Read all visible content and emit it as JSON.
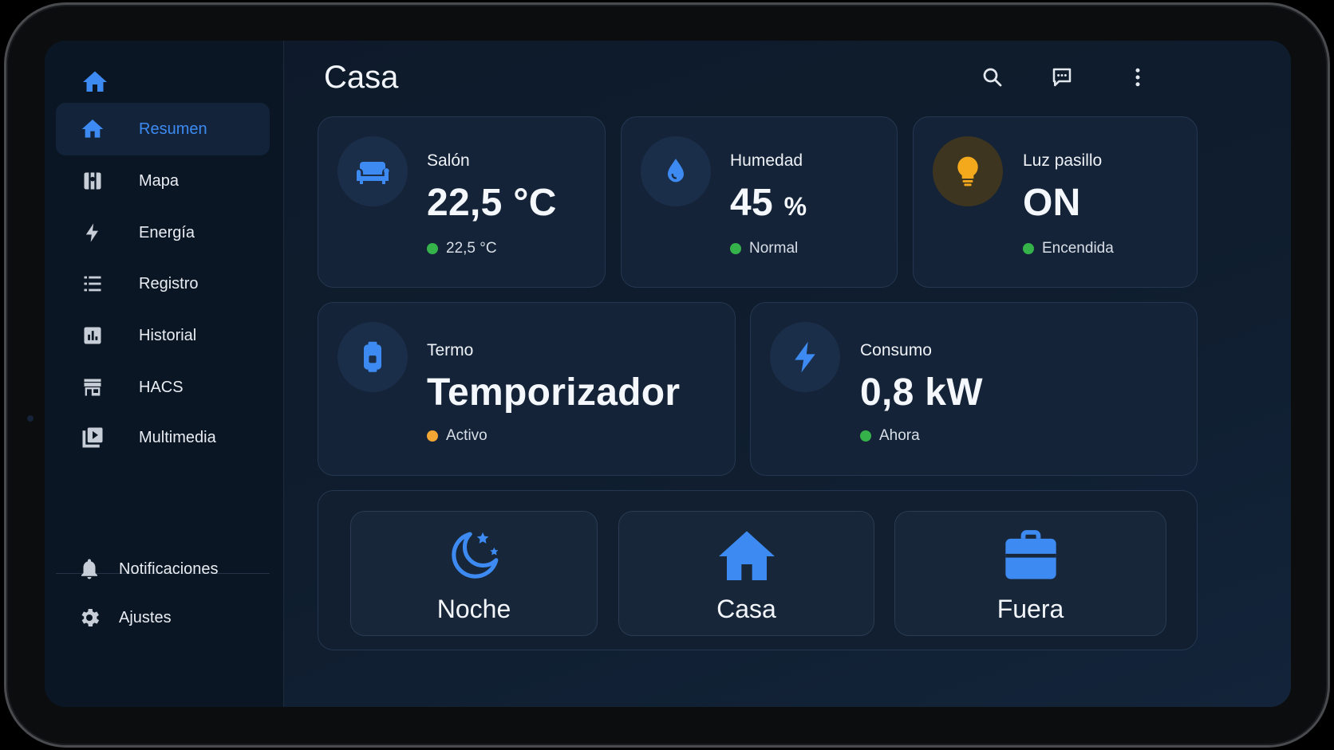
{
  "app": {
    "title": "Casa"
  },
  "sidebar": {
    "items": [
      {
        "label": "Resumen",
        "icon": "home-icon",
        "active": true
      },
      {
        "label": "Mapa",
        "icon": "map-icon"
      },
      {
        "label": "Energía",
        "icon": "lightning-icon"
      },
      {
        "label": "Registro",
        "icon": "list-icon"
      },
      {
        "label": "Historial",
        "icon": "chart-icon"
      },
      {
        "label": "HACS",
        "icon": "store-icon"
      },
      {
        "label": "Multimedia",
        "icon": "media-icon"
      }
    ],
    "footer": [
      {
        "label": "Notificaciones",
        "icon": "bell-icon"
      },
      {
        "label": "Ajustes",
        "icon": "gear-icon"
      }
    ]
  },
  "toolbar": {
    "icons": [
      "search-icon",
      "assist-chat-icon",
      "more-vert-icon"
    ]
  },
  "cards": {
    "salon": {
      "label": "Salón",
      "value": "22,5 °C",
      "status": "22,5 °C",
      "status_color": "#35b34a",
      "icon": "sofa-icon"
    },
    "humedad": {
      "label": "Humedad",
      "value": "45",
      "unit": "%",
      "status": "Normal",
      "status_color": "#35b34a",
      "icon": "water-drop-icon"
    },
    "luz": {
      "label": "Luz pasillo",
      "value": "ON",
      "status": "Encendida",
      "status_color": "#35b34a",
      "icon": "lightbulb-icon"
    },
    "termo": {
      "label": "Termo",
      "value": "Temporizador",
      "status": "Activo",
      "status_color": "#f2a634",
      "icon": "water-heater-icon"
    },
    "consumo": {
      "label": "Consumo",
      "value": "0,8 kW",
      "status": "Ahora",
      "status_color": "#35b34a",
      "icon": "lightning-icon"
    }
  },
  "scenes": [
    {
      "label": "Noche",
      "icon": "moon-stars-icon"
    },
    {
      "label": "Casa",
      "icon": "home-icon"
    },
    {
      "label": "Fuera",
      "icon": "briefcase-icon"
    }
  ],
  "colors": {
    "accent": "#3d8bf2",
    "bulb": "#f4a81c"
  }
}
